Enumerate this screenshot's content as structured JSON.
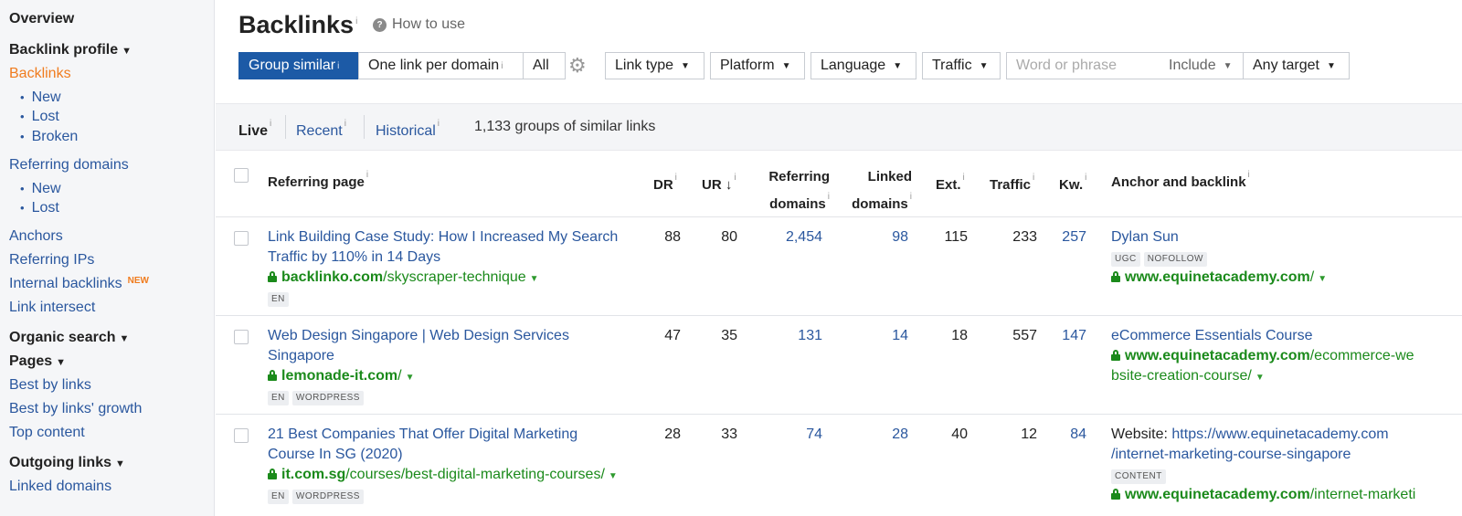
{
  "sidebar": {
    "overview": "Overview",
    "backlink_profile": "Backlink profile",
    "backlinks": "Backlinks",
    "backlinks_new": "New",
    "backlinks_lost": "Lost",
    "backlinks_broken": "Broken",
    "referring_domains": "Referring domains",
    "rd_new": "New",
    "rd_lost": "Lost",
    "anchors": "Anchors",
    "referring_ips": "Referring IPs",
    "internal_backlinks": "Internal backlinks",
    "new_badge": "NEW",
    "link_intersect": "Link intersect",
    "organic_search": "Organic search",
    "pages": "Pages",
    "best_by_links": "Best by links",
    "best_by_links_growth": "Best by links' growth",
    "top_content": "Top content",
    "outgoing_links": "Outgoing links",
    "linked_domains": "Linked domains"
  },
  "header": {
    "title": "Backlinks",
    "info": "i",
    "how_to_use": "How to use"
  },
  "toolbar": {
    "group_similar": "Group similar",
    "one_link_per_domain": "One link per domain",
    "all": "All",
    "link_type": "Link type",
    "platform": "Platform",
    "language": "Language",
    "traffic": "Traffic",
    "search_placeholder": "Word or phrase",
    "include": "Include",
    "any_target": "Any target"
  },
  "livebar": {
    "live": "Live",
    "recent": "Recent",
    "historical": "Historical",
    "summary": "1,133 groups of similar links"
  },
  "columns": {
    "referring_page": "Referring page",
    "dr": "DR",
    "ur": "UR",
    "sort_arrow": "↓",
    "referring_domains_1": "Referring",
    "referring_domains_2": "domains",
    "linked_domains_1": "Linked",
    "linked_domains_2": "domains",
    "ext": "Ext.",
    "traffic": "Traffic",
    "kw": "Kw.",
    "anchor": "Anchor and backlink"
  },
  "rows": [
    {
      "title_1": "Link Building Case Study: How I Increased My Search",
      "title_2": "Traffic by 110% in 14 Days",
      "domain": "backlinko.com",
      "path": "/skyscraper-technique",
      "tags": [
        "EN"
      ],
      "dr": "88",
      "ur": "80",
      "ref_domains": "2,454",
      "linked_domains": "98",
      "ext": "115",
      "traffic": "233",
      "kw": "257",
      "anchor_text": "Dylan Sun",
      "anchor_tags": [
        "UGC",
        "NOFOLLOW"
      ],
      "target_domain": "www.equinetacademy.com",
      "target_path": "/"
    },
    {
      "title_1": "Web Design Singapore | Web Design Services",
      "title_2": "Singapore",
      "domain": "lemonade-it.com",
      "path": "/",
      "tags": [
        "EN",
        "WORDPRESS"
      ],
      "dr": "47",
      "ur": "35",
      "ref_domains": "131",
      "linked_domains": "14",
      "ext": "18",
      "traffic": "557",
      "kw": "147",
      "anchor_text": "eCommerce Essentials Course",
      "target_domain": "www.equinetacademy.com",
      "target_path_1": "/ecommerce-we",
      "target_path_2": "bsite-creation-course/"
    },
    {
      "title_1": "21 Best Companies That Offer Digital Marketing",
      "title_2": "Course In SG (2020)",
      "domain": "it.com.sg",
      "path": "/courses/best-digital-marketing-courses/",
      "tags": [
        "EN",
        "WORDPRESS"
      ],
      "dr": "28",
      "ur": "33",
      "ref_domains": "74",
      "linked_domains": "28",
      "ext": "40",
      "traffic": "12",
      "kw": "84",
      "anchor_label": "Website:",
      "anchor_link_1": "https://www.equinetacademy.com",
      "anchor_link_2": "/internet-marketing-course-singapore",
      "anchor_tags": [
        "CONTENT"
      ],
      "target_domain": "www.equinetacademy.com",
      "target_path": "/internet-marketi"
    }
  ]
}
